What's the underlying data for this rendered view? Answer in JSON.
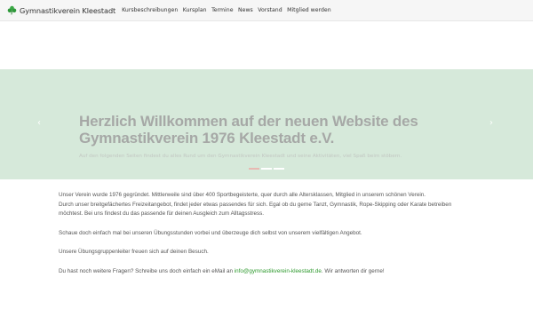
{
  "navbar": {
    "brand": "Gymnastikverein Kleestadt",
    "links": [
      "Kursbeschreibungen",
      "Kursplan",
      "Termine",
      "News",
      "Vorstand",
      "Mitglied werden"
    ]
  },
  "hero": {
    "title": "Herzlich Willkommen auf der neuen Website des Gymnastikverein 1976 Kleestadt e.V.",
    "subtitle": "Auf den folgenden Seiten findest du alles Rund um den Gymnastikverein Kleestadt und seine Aktivitäten, viel Spaß beim stöbern.",
    "prev_icon": "chevron-left-icon",
    "next_icon": "chevron-right-icon"
  },
  "content": {
    "p1_line1": "Unser Verein wurde 1976 gegründet. Mittlerweile sind über 400 Sportbegeisterte, quer durch alle Altersklassen, Mitglied in unserem schönen Verein.",
    "p1_line2": "Durch unser breitgefächertes Freizeitangebot, findet jeder etwas passendes für sich. Egal ob du gerne Tanzt, Gymnastik, Rope-Skipping oder Karate betreiben möchtest. Bei uns findest du das passende für deinen Ausgleich zum Alltagsstress.",
    "p2": "Schaue doch einfach mal bei unseren Übungsstunden vorbei und überzeuge dich selbst von unserem vielfältigen Angebot.",
    "p3": "Unsere Übungsgruppenleiter freuen sich auf deinen Besuch.",
    "p4_before": "Du hast noch weitere Fragen? Schreibe uns doch einfach ein eMail an ",
    "p4_email": "info@gymnastikverein-kleestadt.de",
    "p4_after": ". Wir antworten dir gerne!"
  },
  "colors": {
    "hero_background": "#d6e9da",
    "link_green": "#2e9a2e",
    "active_indicator": "#e8b9b2"
  }
}
